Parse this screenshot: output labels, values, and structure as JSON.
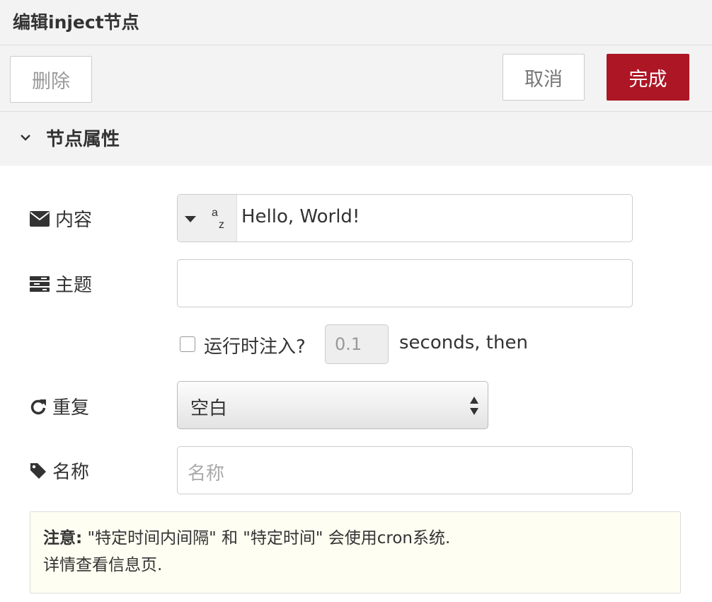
{
  "tray": {
    "title": "编辑inject节点"
  },
  "toolbar": {
    "delete_label": "删除",
    "cancel_label": "取消",
    "done_label": "完成"
  },
  "section": {
    "title": "节点属性"
  },
  "form": {
    "payload": {
      "label": "内容",
      "type_icon": "az-string-icon",
      "value": "Hello, World!"
    },
    "topic": {
      "label": "主题",
      "value": ""
    },
    "once": {
      "label": "运行时注入?",
      "checked": false,
      "delay_value": "0.1",
      "suffix": "seconds, then"
    },
    "repeat": {
      "label": "重复",
      "selected": "空白"
    },
    "name": {
      "label": "名称",
      "placeholder": "名称",
      "value": ""
    }
  },
  "tip": {
    "bold": "注意:",
    "line1": " \"特定时间内间隔\" 和 \"特定时间\" 会使用cron系统.",
    "line2": "详情查看信息页."
  },
  "colors": {
    "primary": "#ad1625",
    "panel": "#f3f3f3",
    "tip_bg": "#fefef2"
  }
}
